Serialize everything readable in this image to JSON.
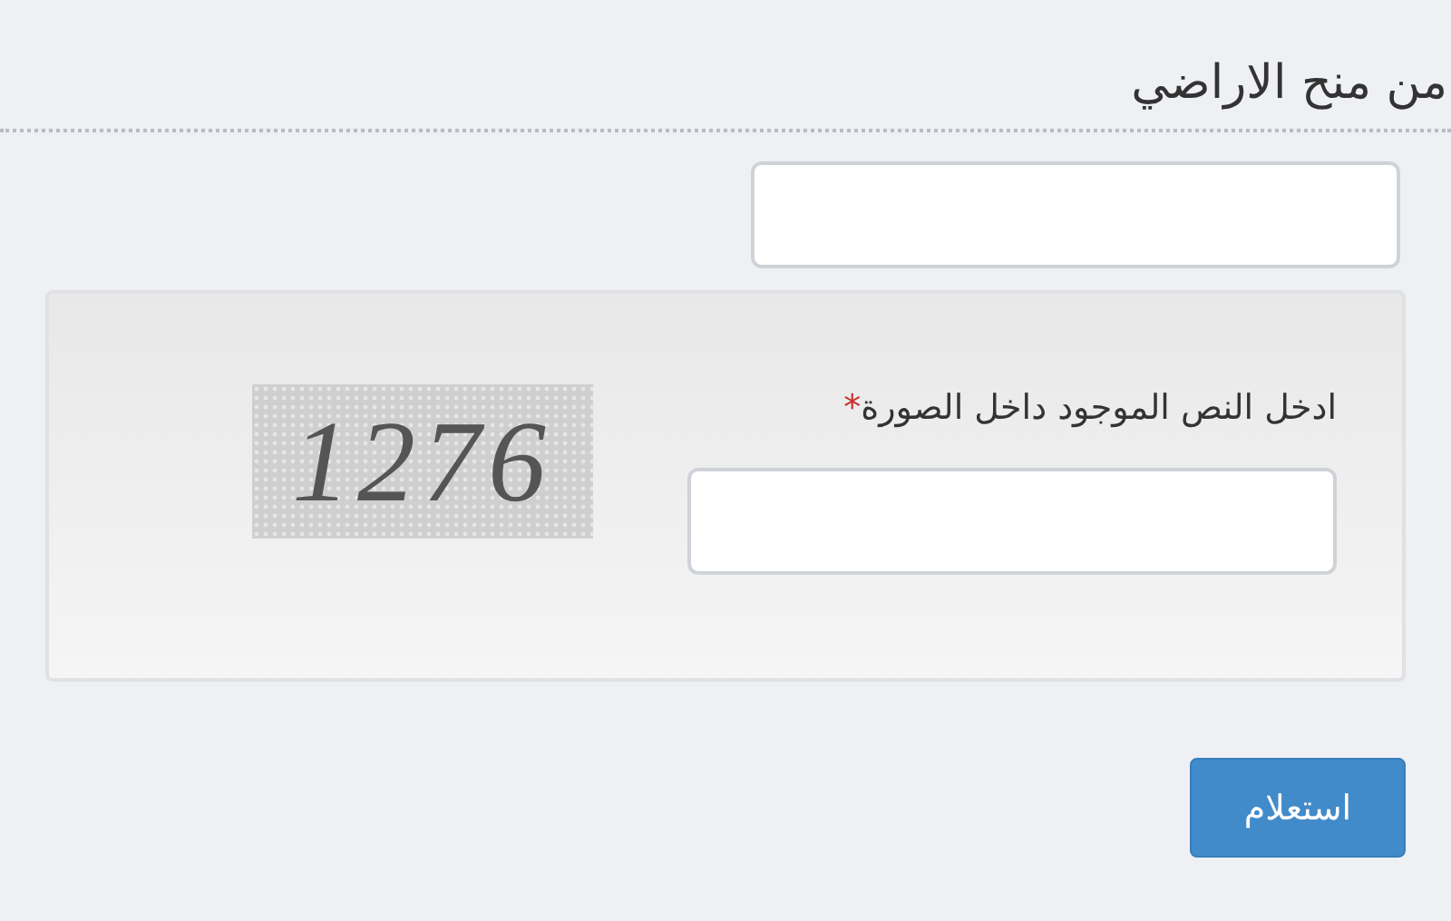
{
  "title": "من منح الاراضي",
  "captcha": {
    "label": "ادخل النص الموجود داخل الصورة",
    "required_mark": "*",
    "code": "1276"
  },
  "submit_button": "استعلام"
}
